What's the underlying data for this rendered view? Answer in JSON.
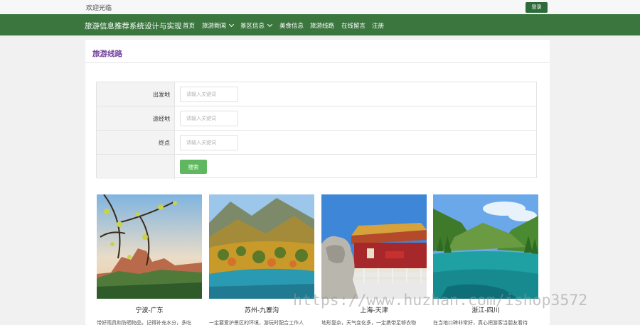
{
  "topbar": {
    "welcome": "欢迎光临",
    "login_label": "登录"
  },
  "nav": {
    "brand": "旅游信息推荐系统设计与实现",
    "items": [
      "首页",
      "旅游新闻",
      "景区信息",
      "美食信息",
      "旅游线路",
      "在线留言",
      "注册"
    ],
    "background_color": "#3b763e"
  },
  "panel": {
    "title": "旅游线路"
  },
  "search": {
    "fields": [
      {
        "label": "出发地",
        "placeholder": "请输入关键词"
      },
      {
        "label": "途经地",
        "placeholder": "请输入关键词"
      },
      {
        "label": "终点",
        "placeholder": "请输入关键词"
      }
    ],
    "button_label": "搜索",
    "button_color": "#5fb85f"
  },
  "routes": [
    {
      "title": "宁波-广东",
      "desc": "带好雨具和防晒物品，记得补充水分，多吃",
      "image": "mountain-with-branches"
    },
    {
      "title": "苏州-九寨沟",
      "desc": "一定要爱护景区的环境，游玩时配合工作人",
      "image": "autumn-mountain-lake"
    },
    {
      "title": "上海-天津",
      "desc": "地形复杂，天气变化多，一定携带足够衣物",
      "image": "city-gate-with-lion"
    },
    {
      "title": "浙江-四川",
      "desc": "在当地口碑非常好，真心把游客当朋友看待",
      "image": "green-valley-lake"
    }
  ],
  "watermark": "https://www.huzhan.com/ishop3572"
}
